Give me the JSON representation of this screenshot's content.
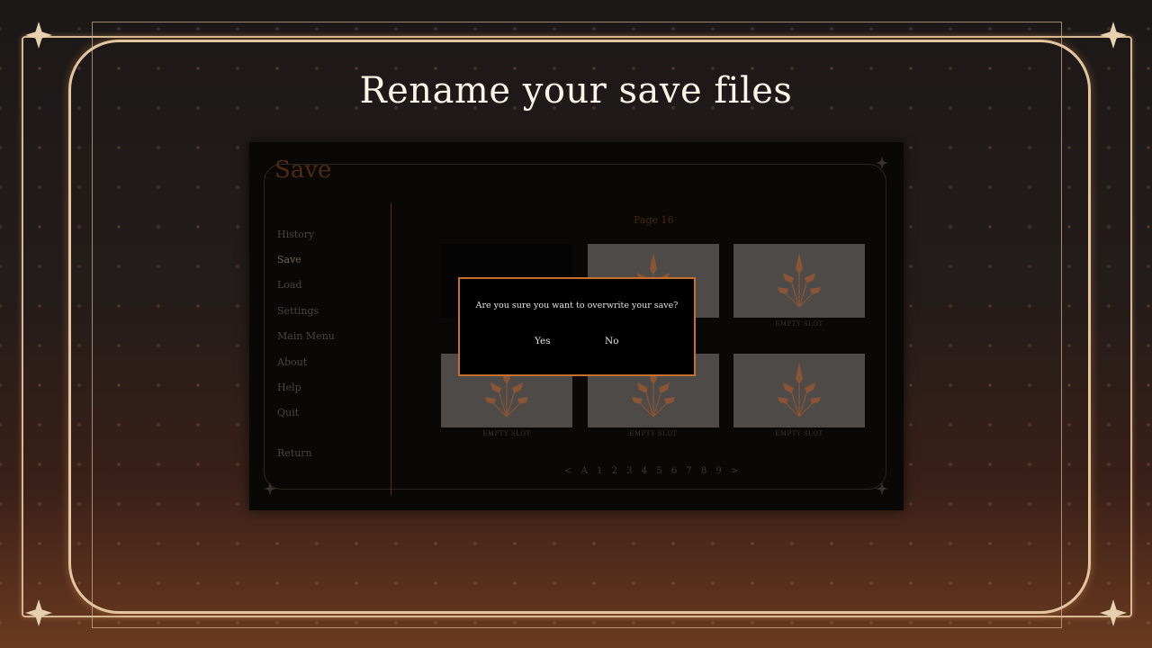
{
  "heading": "Rename your save files",
  "screenshot": {
    "screen_title": "Save",
    "menu": [
      "History",
      "Save",
      "Load",
      "Settings",
      "Main Menu",
      "About",
      "Help",
      "Quit"
    ],
    "return_label": "Return",
    "page_label": "Page 16",
    "slots": [
      {
        "label": ""
      },
      {
        "label": ""
      },
      {
        "label": "EMPTY SLOT"
      },
      {
        "label": "EMPTY SLOT"
      },
      {
        "label": "EMPTY SLOT"
      },
      {
        "label": "EMPTY SLOT"
      }
    ],
    "pager": [
      "<",
      "A",
      "1",
      "2",
      "3",
      "4",
      "5",
      "6",
      "7",
      "8",
      "9",
      ">"
    ],
    "dialog": {
      "message": "Are you sure you want to overwrite your save?",
      "yes": "Yes",
      "no": "No"
    }
  },
  "colors": {
    "accent": "#c7702e",
    "frame": "#e3c6a0",
    "title_text": "#fbf3e6"
  }
}
